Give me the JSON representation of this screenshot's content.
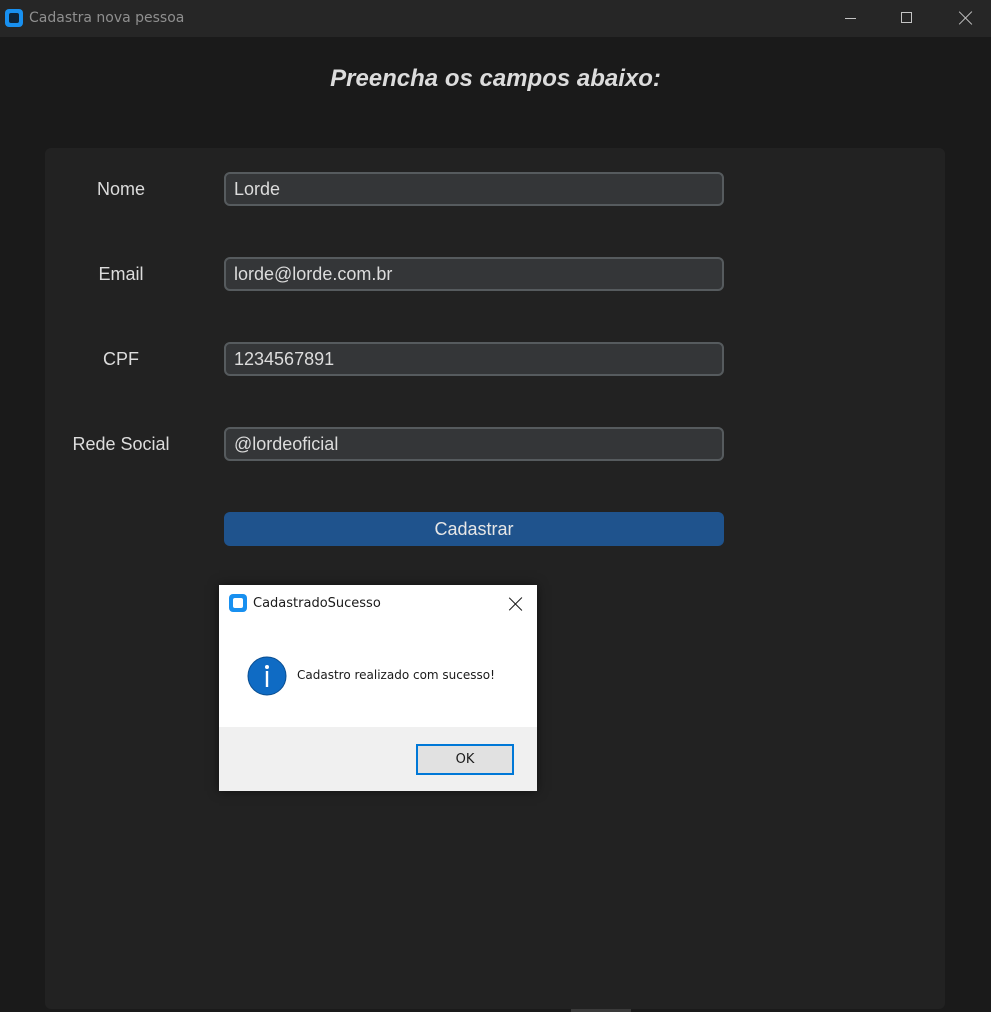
{
  "window": {
    "title": "Cadastra nova pessoa",
    "accent_color": "#1890f0"
  },
  "heading": "Preencha os campos abaixo:",
  "form": {
    "fields": [
      {
        "label": "Nome",
        "value": "Lorde"
      },
      {
        "label": "Email",
        "value": "lorde@lorde.com.br"
      },
      {
        "label": "CPF",
        "value": "1234567891"
      },
      {
        "label": "Rede Social",
        "value": "@lordeoficial"
      }
    ],
    "submit_label": "Cadastrar",
    "submit_color": "#1f538d"
  },
  "dialog": {
    "title": "CadastradoSucesso",
    "icon": "info-icon",
    "message": "Cadastro realizado com sucesso!",
    "ok_label": "OK"
  }
}
